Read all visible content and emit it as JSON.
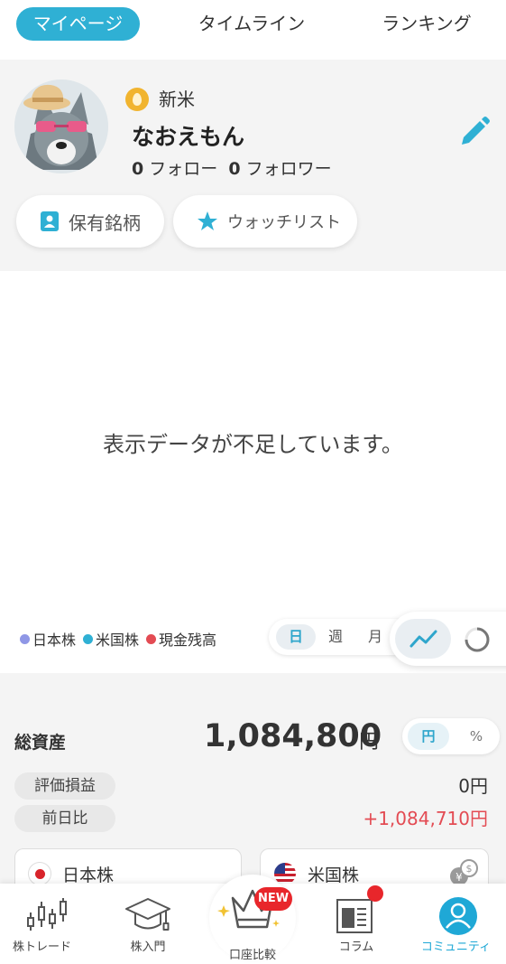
{
  "tabs": [
    {
      "label": "マイページ",
      "active": true
    },
    {
      "label": "タイムライン",
      "active": false
    },
    {
      "label": "ランキング",
      "active": false
    }
  ],
  "profile": {
    "rank": "新米",
    "username": "なおえもん",
    "following_count": "0",
    "following_label": "フォロー",
    "followers_count": "0",
    "followers_label": "フォロワー",
    "holdings_button": "保有銘柄",
    "watchlist_button": "ウォッチリスト"
  },
  "chart": {
    "empty_message": "表示データが不足しています。",
    "legend": [
      {
        "label": "日本株",
        "color": "#8f97e6"
      },
      {
        "label": "米国株",
        "color": "#2fb0d4"
      },
      {
        "label": "現金残高",
        "color": "#e34b53"
      }
    ],
    "periods": [
      {
        "label": "日",
        "active": true
      },
      {
        "label": "週",
        "active": false
      },
      {
        "label": "月",
        "active": false
      }
    ]
  },
  "assets": {
    "total_label": "総資産",
    "total_value": "1,084,800",
    "total_unit": "円",
    "unit_options": [
      "円",
      "%"
    ],
    "profit_label": "評価損益",
    "profit_value": "0円",
    "daily_label": "前日比",
    "daily_value": "+1,084,710円",
    "daily_color": "#e34b53",
    "cards": [
      {
        "label": "日本株",
        "icon": "japan-flag-icon"
      },
      {
        "label": "米国株",
        "icon": "us-flag-icon"
      }
    ]
  },
  "bottom_nav": {
    "items": [
      {
        "label": "株トレード",
        "icon": "candlestick-icon",
        "active": false
      },
      {
        "label": "株入門",
        "icon": "graduation-cap-icon",
        "active": false
      },
      {
        "label": "口座比較",
        "icon": "crown-icon",
        "active": false
      },
      {
        "label": "コラム",
        "icon": "newspaper-icon",
        "active": false
      },
      {
        "label": "コミュニティ",
        "icon": "person-icon",
        "active": true
      }
    ],
    "new_badge": "NEW"
  },
  "colors": {
    "accent": "#2fb0d4",
    "negative": "#e34b53"
  }
}
